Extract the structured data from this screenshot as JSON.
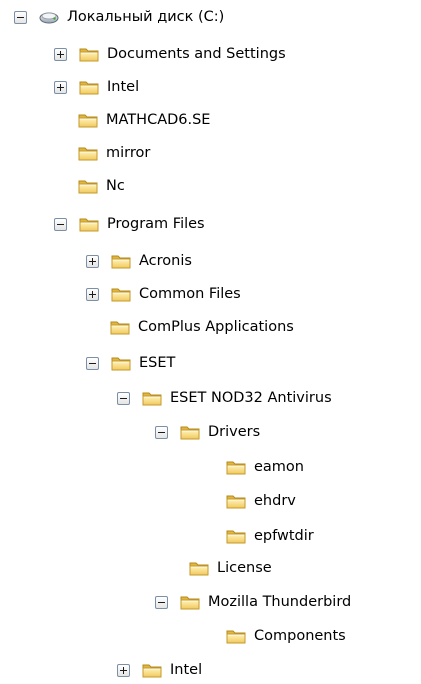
{
  "tree": {
    "drive": {
      "label": "Локальный диск (C:)",
      "icon": "hard-drive-icon"
    },
    "documents_and_settings": {
      "label": "Documents and Settings",
      "icon": "folder-icon",
      "state": "collapsed"
    },
    "intel_root": {
      "label": "Intel",
      "icon": "folder-icon",
      "state": "collapsed"
    },
    "mathcad": {
      "label": "MATHCAD6.SE",
      "icon": "folder-icon"
    },
    "mirror": {
      "label": "mirror",
      "icon": "folder-icon"
    },
    "nc": {
      "label": "Nc",
      "icon": "folder-icon"
    },
    "program_files": {
      "label": "Program Files",
      "icon": "folder-icon",
      "state": "expanded"
    },
    "acronis": {
      "label": "Acronis",
      "icon": "folder-icon",
      "state": "collapsed"
    },
    "common_files": {
      "label": "Common Files",
      "icon": "folder-icon",
      "state": "collapsed"
    },
    "complus": {
      "label": "ComPlus Applications",
      "icon": "folder-icon"
    },
    "eset": {
      "label": "ESET",
      "icon": "folder-icon",
      "state": "expanded"
    },
    "eset_nod32": {
      "label": "ESET NOD32 Antivirus",
      "icon": "folder-icon",
      "state": "expanded"
    },
    "drivers": {
      "label": "Drivers",
      "icon": "folder-icon",
      "state": "expanded"
    },
    "eamon": {
      "label": "eamon",
      "icon": "folder-icon"
    },
    "ehdrv": {
      "label": "ehdrv",
      "icon": "folder-icon"
    },
    "epfwtdir": {
      "label": "epfwtdir",
      "icon": "folder-icon"
    },
    "license": {
      "label": "License",
      "icon": "folder-icon"
    },
    "mozilla_thunderbird": {
      "label": "Mozilla Thunderbird",
      "icon": "folder-icon",
      "state": "expanded"
    },
    "components": {
      "label": "Components",
      "icon": "folder-icon"
    },
    "intel_program_files": {
      "label": "Intel",
      "icon": "folder-icon",
      "state": "collapsed"
    }
  },
  "colors": {
    "folder_body": "#f6d97a",
    "folder_outline": "#c69a2c",
    "toggle_border": "#7b8fa6",
    "text": "#000000",
    "background": "#ffffff"
  }
}
